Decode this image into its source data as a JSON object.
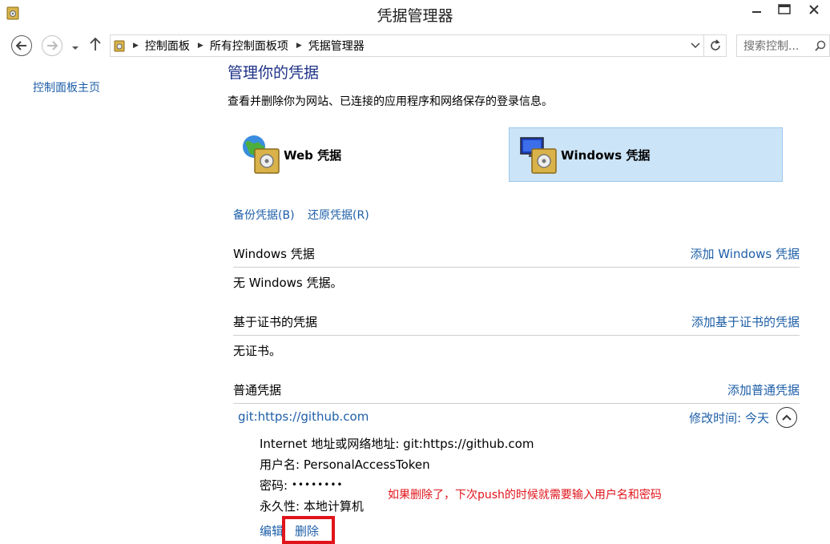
{
  "window": {
    "title": "凭据管理器"
  },
  "nav": {
    "breadcrumbs": [
      "控制面板",
      "所有控制面板项",
      "凭据管理器"
    ],
    "search_placeholder": "搜索控制..."
  },
  "sidebar": {
    "home_link": "控制面板主页"
  },
  "main": {
    "title": "管理你的凭据",
    "description": "查看并删除你为网站、已连接的应用程序和网络保存的登录信息。",
    "tiles": [
      {
        "label": "Web 凭据",
        "selected": false
      },
      {
        "label": "Windows 凭据",
        "selected": true
      }
    ],
    "backup_link": "备份凭据(B)",
    "restore_link": "还原凭据(R)",
    "sections": [
      {
        "title": "Windows 凭据",
        "add_link": "添加 Windows 凭据",
        "empty_text": "无 Windows 凭据。"
      },
      {
        "title": "基于证书的凭据",
        "add_link": "添加基于证书的凭据",
        "empty_text": "无证书。"
      },
      {
        "title": "普通凭据",
        "add_link": "添加普通凭据"
      }
    ],
    "entry": {
      "name": "git:https://github.com",
      "modified_label": "修改时间:",
      "modified_value": "今天",
      "details": {
        "address_label": "Internet 地址或网络地址:",
        "address_value": "git:https://github.com",
        "username_label": "用户名:",
        "username_value": "PersonalAccessToken",
        "password_label": "密码:",
        "password_value": "••••••••",
        "persistence_label": "永久性:",
        "persistence_value": "本地计算机"
      },
      "edit_link": "编辑",
      "delete_link": "删除"
    },
    "annotation": "如果删除了，下次push的时候就需要输入用户名和密码"
  },
  "colors": {
    "link": "#1e5fa8",
    "title": "#1e3287",
    "selected_tile": "#cce4f7",
    "annotation": "#e0151b"
  }
}
